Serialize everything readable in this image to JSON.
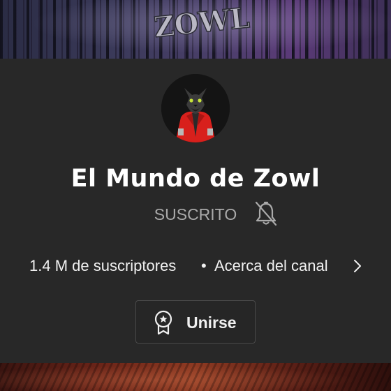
{
  "banner": {
    "logo_text": "ZOWL",
    "bottom_text": ""
  },
  "channel": {
    "name": "El Mundo de Zowl",
    "avatar_icon": "wolf-in-red-jacket-avatar"
  },
  "subscription": {
    "status_label": "SUSCRITO",
    "bell_icon": "bell-off-icon"
  },
  "stats": {
    "subscribers": "1.4 M de suscriptores",
    "separator": "•",
    "about_label": "Acerca del canal",
    "chevron_icon": "chevron-right-icon"
  },
  "join": {
    "label": "Unirse",
    "icon": "membership-badge-icon"
  },
  "colors": {
    "background": "#282828",
    "text_primary": "#ffffff",
    "text_secondary": "#aaaaaa",
    "avatar_jacket": "#d8201c"
  }
}
